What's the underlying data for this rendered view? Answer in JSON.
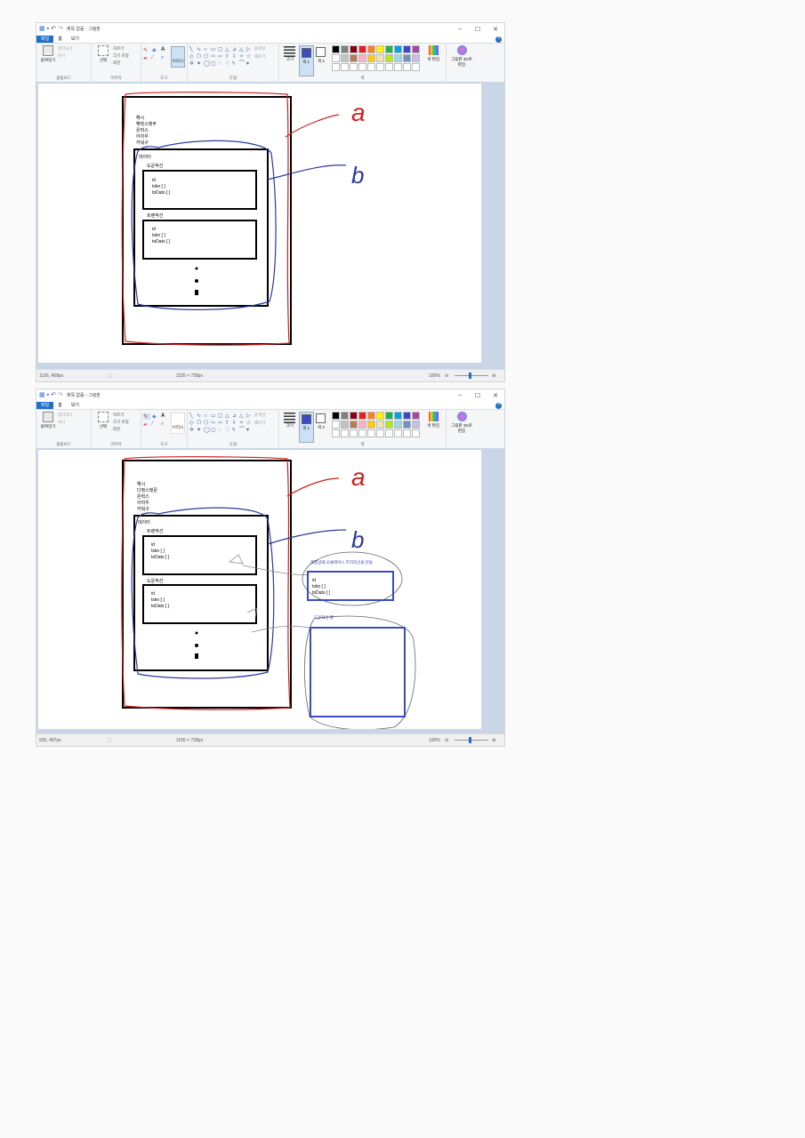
{
  "screens": [
    {
      "app_title": "제목 없음 - 그림판",
      "tabs": [
        "파일",
        "홈",
        "보기"
      ],
      "ribbon": {
        "clipboard": {
          "paste": "붙여넣기",
          "cut": "잘라내기",
          "copy": "복사",
          "label": "클립보드"
        },
        "image": {
          "select": "선택",
          "crop": "자르기",
          "resize": "크기 조정",
          "rotate": "회전",
          "label": "이미지"
        },
        "tools": {
          "brushes": "브러시",
          "label": "도구"
        },
        "shapes": {
          "outline": "윤곽선",
          "fill": "채우기",
          "label": "도형"
        },
        "size": "크기",
        "color1": "색 1",
        "color2": "색 2",
        "edit_colors": "색 편집",
        "paint3d": "그림판 3D로 편집",
        "colors_label": "색"
      },
      "canvas": {
        "menu_items": [
          "해시",
          "해밍스탯주",
          "온력스",
          "아차우",
          "카워구"
        ],
        "outer_label": "데이터",
        "cards": [
          {
            "title": "도운작선",
            "fields": [
              "id",
              "tskn [ ]",
              "toDats [ ]"
            ]
          },
          {
            "title": "트렌작선",
            "fields": [
              "id",
              "tskn [ ]",
              "toDats [ ]"
            ]
          }
        ],
        "letter_a": "a",
        "letter_b": "b"
      },
      "status": {
        "cursor": "1106, 458px",
        "size": "1155 × 728px",
        "zoom": "100%"
      }
    },
    {
      "app_title": "제목 없음 - 그림판",
      "tabs": [
        "파일",
        "홈",
        "보기"
      ],
      "ribbon": {
        "clipboard": {
          "paste": "붙여넣기",
          "cut": "잘라내기",
          "copy": "복사",
          "label": "클립보드"
        },
        "image": {
          "select": "선택",
          "crop": "자르기",
          "resize": "크기 조정",
          "rotate": "회전",
          "label": "이미지"
        },
        "tools": {
          "brushes": "브러시",
          "label": "도구"
        },
        "shapes": {
          "outline": "윤곽선",
          "fill": "채우기",
          "label": "도형"
        },
        "size": "크기",
        "color1": "색 1",
        "color2": "색 2",
        "edit_colors": "색 편집",
        "paint3d": "그림판 3D로 편집",
        "colors_label": "색"
      },
      "canvas": {
        "menu_items": [
          "해시",
          "다정스탯문",
          "온력스",
          "아차우",
          "카워구"
        ],
        "outer_label": "데이터",
        "cards": [
          {
            "title": "트렌작선",
            "fields": [
              "id",
              "tskn [ ]",
              "toDats [ ]"
            ]
          },
          {
            "title": "도운작선",
            "fields": [
              "id",
              "tskn [ ]",
              "toDats [ ]"
            ]
          }
        ],
        "letter_a": "a",
        "letter_b": "b",
        "note_1": "해결상태 오류테이스 트리작선을 만들",
        "note_1_fields": [
          "id",
          "tskn [ ]",
          "toDats [ ]"
        ],
        "note_2": "도운작선 블"
      },
      "status": {
        "cursor": "526, 457px",
        "size": "1155 × 728px",
        "zoom": "100%"
      }
    }
  ],
  "colors": {
    "selected_color": "#3b4cc0",
    "accent": "#1e6fc8",
    "red_annotation": "#cc2020",
    "blue_annotation": "#2b3a9e",
    "palette": [
      "#000000",
      "#7f7f7f",
      "#880015",
      "#ed1c24",
      "#ff7f27",
      "#fff200",
      "#22b14c",
      "#00a2e8",
      "#3f48cc",
      "#a349a4",
      "#ffffff",
      "#c3c3c3",
      "#b97a57",
      "#ffaec9",
      "#ffc90e",
      "#efe4b0",
      "#b5e61d",
      "#99d9ea",
      "#7092be",
      "#c8bfe7",
      "#ffffff",
      "#ffffff",
      "#ffffff",
      "#ffffff",
      "#ffffff",
      "#ffffff",
      "#ffffff",
      "#ffffff",
      "#ffffff",
      "#ffffff"
    ]
  },
  "icons": [
    "save-icon",
    "undo-icon",
    "redo-icon",
    "pencil-icon",
    "fill-icon",
    "text-icon",
    "eraser-icon",
    "color-picker-icon",
    "magnifier-icon",
    "minimize-icon",
    "maximize-icon",
    "close-icon",
    "help-icon"
  ]
}
